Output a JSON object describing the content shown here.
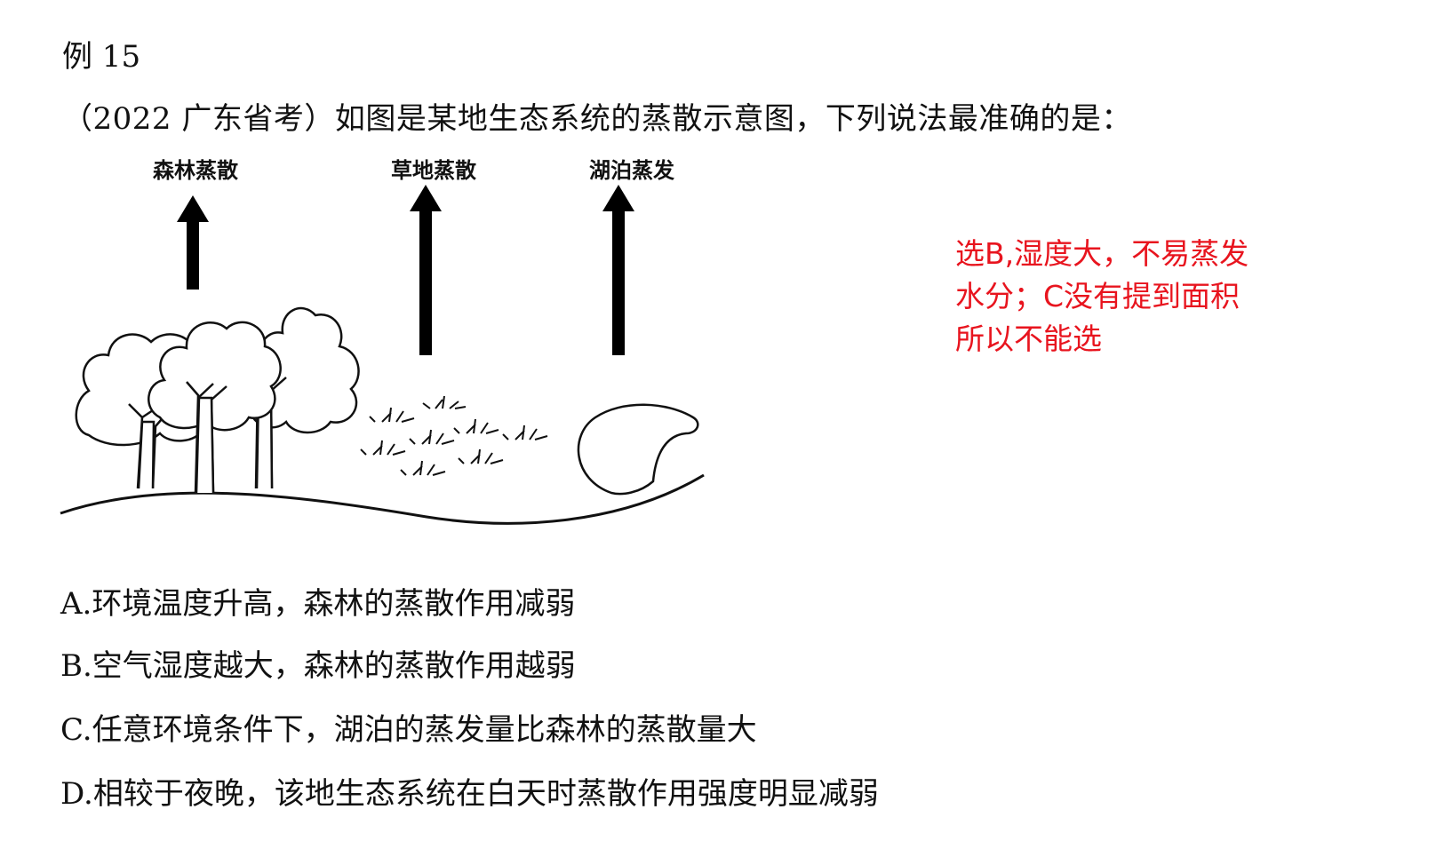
{
  "example_label": "例 15",
  "question": "（2022 广东省考）如图是某地生态系统的蒸散示意图，下列说法最准确的是：",
  "figure": {
    "labels": [
      "森林蒸散",
      "草地蒸散",
      "湖泊蒸发"
    ]
  },
  "answer_note": "选B,湿度大，不易蒸发水分；C没有提到面积所以不能选",
  "options": [
    "A.环境温度升高，森林的蒸散作用减弱",
    "B.空气湿度越大，森林的蒸散作用越弱",
    "C.任意环境条件下，湖泊的蒸发量比森林的蒸散量大",
    "D.相较于夜晚，该地生态系统在白天时蒸散作用强度明显减弱"
  ],
  "colors": {
    "note": "#e8141e",
    "text": "#111111"
  }
}
